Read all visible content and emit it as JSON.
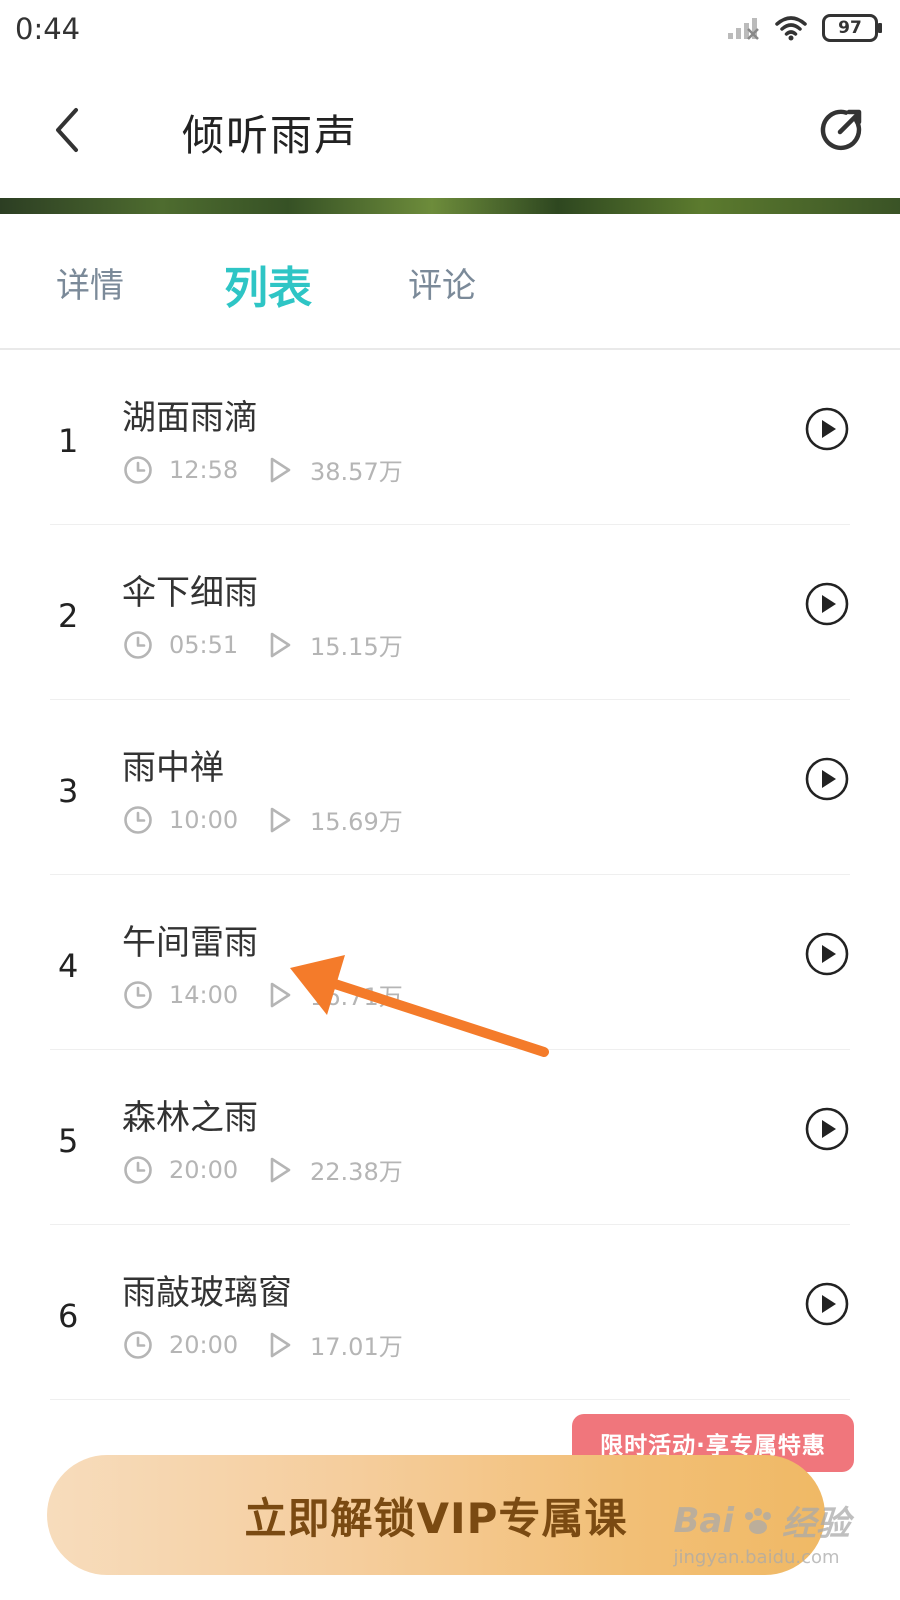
{
  "status_bar": {
    "time": "0:44",
    "battery": "97"
  },
  "header": {
    "title": "倾听雨声"
  },
  "tabs": [
    {
      "label": "详情",
      "active": false
    },
    {
      "label": "列表",
      "active": true
    },
    {
      "label": "评论",
      "active": false
    }
  ],
  "tracks": [
    {
      "index": "1",
      "title": "湖面雨滴",
      "duration": "12:58",
      "plays": "38.57万"
    },
    {
      "index": "2",
      "title": "伞下细雨",
      "duration": "05:51",
      "plays": "15.15万"
    },
    {
      "index": "3",
      "title": "雨中禅",
      "duration": "10:00",
      "plays": "15.69万"
    },
    {
      "index": "4",
      "title": "午间雷雨",
      "duration": "14:00",
      "plays": "16.71万"
    },
    {
      "index": "5",
      "title": "森林之雨",
      "duration": "20:00",
      "plays": "22.38万"
    },
    {
      "index": "6",
      "title": "雨敲玻璃窗",
      "duration": "20:00",
      "plays": "17.01万"
    }
  ],
  "promo": {
    "badge": "限时活动·享专属特惠",
    "button_label": "立即解锁VIP专属课"
  },
  "watermark": {
    "brand": "Bai",
    "brand_suffix": "经验",
    "url": "jingyan.baidu.com"
  },
  "colors": {
    "accent": "#2ec5c5",
    "promo_badge": "#f0767c",
    "annotation_arrow": "#f47b2a"
  }
}
